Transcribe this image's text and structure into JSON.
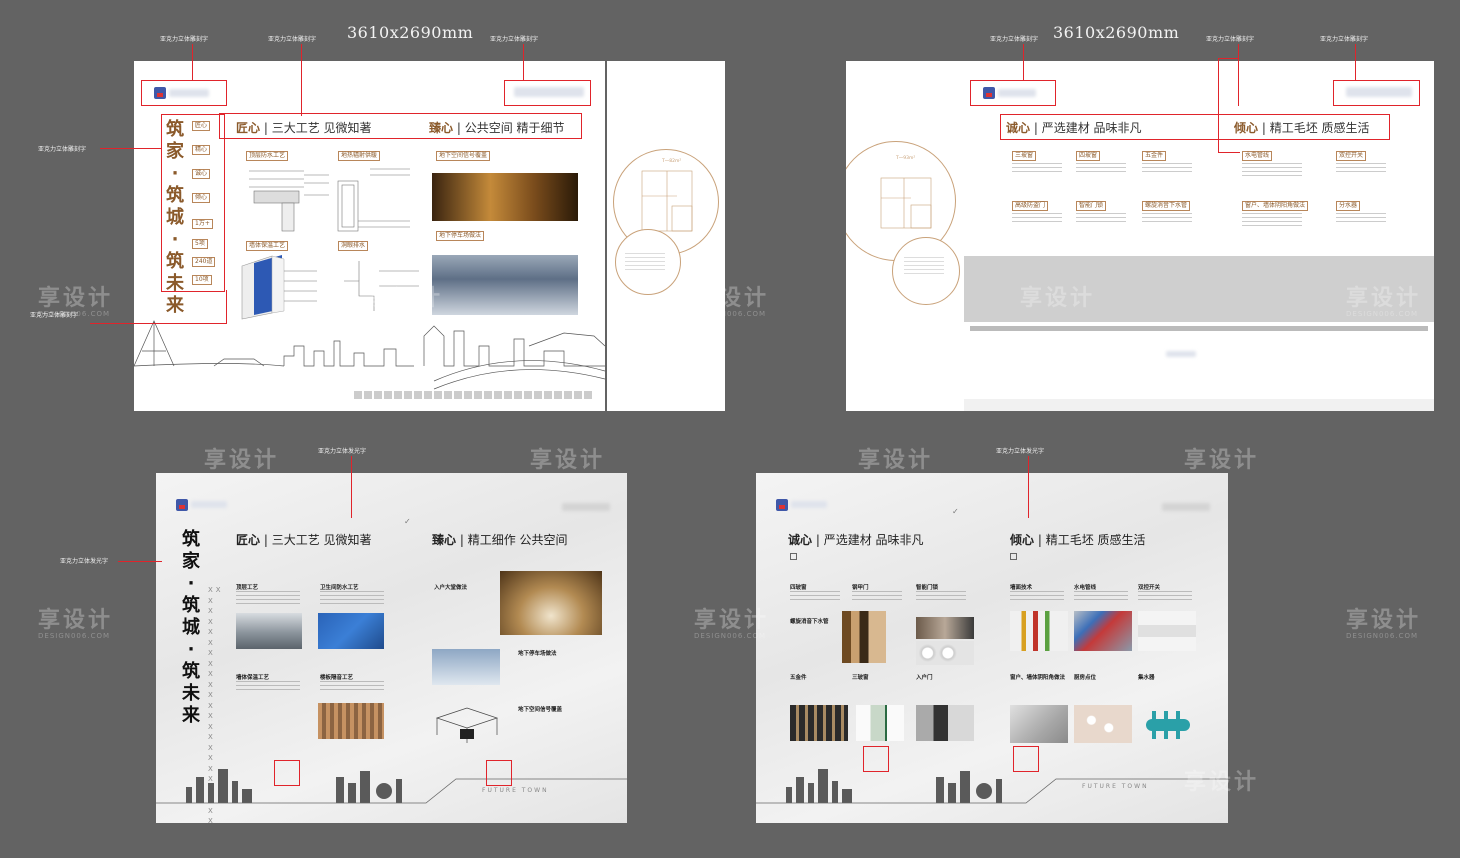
{
  "notes": {
    "acrylic_3d_carve": "亚克力立体雕刻字",
    "acrylic_3d_light": "亚克力立体发光字"
  },
  "dimensions": {
    "board1": "3610x2690mm",
    "board2": "3610x2690mm"
  },
  "board1": {
    "vertical_title_line1": "筑家",
    "vertical_title_line2": "筑城",
    "vertical_title_line3": "筑未来",
    "dot": "·",
    "header_left_key": "匠心",
    "header_left_text": "三大工艺 见微知著",
    "header_right_key": "臻心",
    "header_right_text": "公共空间  精于细节",
    "sep": "|",
    "side_tags": [
      "匠心",
      "精心",
      "诚心",
      "倾心",
      "1万+",
      "5项",
      "240道",
      "10项"
    ],
    "items": [
      "顶层防水工艺",
      "墙体保温工艺",
      "地热辐射供暖",
      "洞眼排水",
      "地下空间信号覆盖",
      "地下停车场做法"
    ],
    "plan_area": "T一82m²"
  },
  "board2": {
    "header_left_key": "诚心",
    "header_left_text": "严选建材 品味非凡",
    "header_right_key": "倾心",
    "header_right_text": "精工毛坯 质感生活",
    "items_row1": [
      "三玻窗",
      "四玻窗",
      "五金件",
      "水电管线",
      "双控开关"
    ],
    "items_row2": [
      "高级防盗门",
      "智能门锁",
      "螺旋消音下水管",
      "窗户、墙体阴阳角做法",
      "分水器"
    ],
    "plan_area": "T一93m²"
  },
  "board3": {
    "vertical_title_line1": "筑家",
    "vertical_title_line2": "筑城",
    "vertical_title_line3": "筑未来",
    "header_left_key": "匠心",
    "header_left_text": "三大工艺 见微知著",
    "header_right_key": "臻心",
    "header_right_text": "精工细作 公共空间",
    "items": [
      "顶层工艺",
      "卫生间防水工艺",
      "墙体保温工艺",
      "楼板隔音工艺",
      "入户大堂做法",
      "地下停车场做法",
      "地下空间信号覆盖"
    ],
    "footer": "FUTURE TOWN",
    "xmarks": "XX"
  },
  "board4": {
    "header_left_key": "诚心",
    "header_left_text": "严选建材 品味非凡",
    "header_right_key": "倾心",
    "header_right_text": "精工毛坯 质感生活",
    "items": [
      "四玻窗",
      "钢甲门",
      "智能门锁",
      "螺旋消音下水管",
      "五金件",
      "三玻窗",
      "入户门",
      "墙面技术",
      "水电管线",
      "双控开关",
      "窗户、墙体阴阳角做法",
      "厨房点位",
      "集水器"
    ],
    "footer": "FUTURE TOWN"
  },
  "watermark": {
    "text": "享设计",
    "sub": "DESIGN006.COM"
  },
  "colors": {
    "background": "#636363",
    "accent_red": "#e0242b",
    "brown": "#8b5a2b"
  }
}
